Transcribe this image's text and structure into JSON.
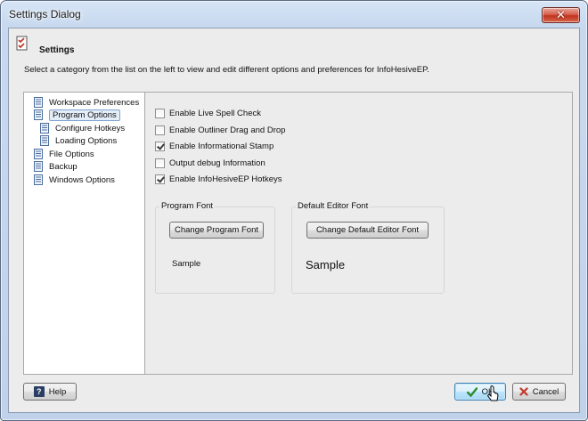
{
  "window": {
    "title": "Settings Dialog",
    "close_glyph": "✕"
  },
  "header": {
    "icon": "checklist-icon",
    "title": "Settings",
    "description": "Select a category from the list on the left to view and edit different options and preferences for InfoHesiveEP."
  },
  "tree": {
    "items": [
      {
        "label": "Workspace Preferences",
        "icon": "page-icon",
        "selected": false,
        "level": 0
      },
      {
        "label": "Program Options",
        "icon": "page-icon",
        "selected": true,
        "level": 0
      },
      {
        "label": "Configure Hotkeys",
        "icon": "page-icon",
        "selected": false,
        "level": 1
      },
      {
        "label": "Loading Options",
        "icon": "page-icon",
        "selected": false,
        "level": 1
      },
      {
        "label": "File Options",
        "icon": "page-icon",
        "selected": false,
        "level": 0
      },
      {
        "label": "Backup",
        "icon": "page-icon",
        "selected": false,
        "level": 0
      },
      {
        "label": "Windows Options",
        "icon": "page-icon",
        "selected": false,
        "level": 0
      }
    ]
  },
  "options": [
    {
      "label": "Enable Live Spell Check",
      "checked": false
    },
    {
      "label": "Enable Outliner Drag and Drop",
      "checked": false
    },
    {
      "label": "Enable Informational Stamp",
      "checked": true
    },
    {
      "label": "Output debug Information",
      "checked": false
    },
    {
      "label": "Enable InfoHesiveEP Hotkeys",
      "checked": true
    }
  ],
  "program_font": {
    "group_label": "Program Font",
    "button_label": "Change Program Font",
    "sample": "Sample"
  },
  "editor_font": {
    "group_label": "Default Editor Font",
    "button_label": "Change Default Editor Font",
    "sample": "Sample"
  },
  "footer": {
    "help_label": "Help",
    "help_icon_glyph": "?",
    "ok_label": "OK",
    "cancel_label": "Cancel"
  },
  "colors": {
    "accent_checkmark": "#2e8b2e",
    "cancel_x": "#c0392b",
    "selection_border": "#7da2ce",
    "title_close": "#c0341f"
  }
}
